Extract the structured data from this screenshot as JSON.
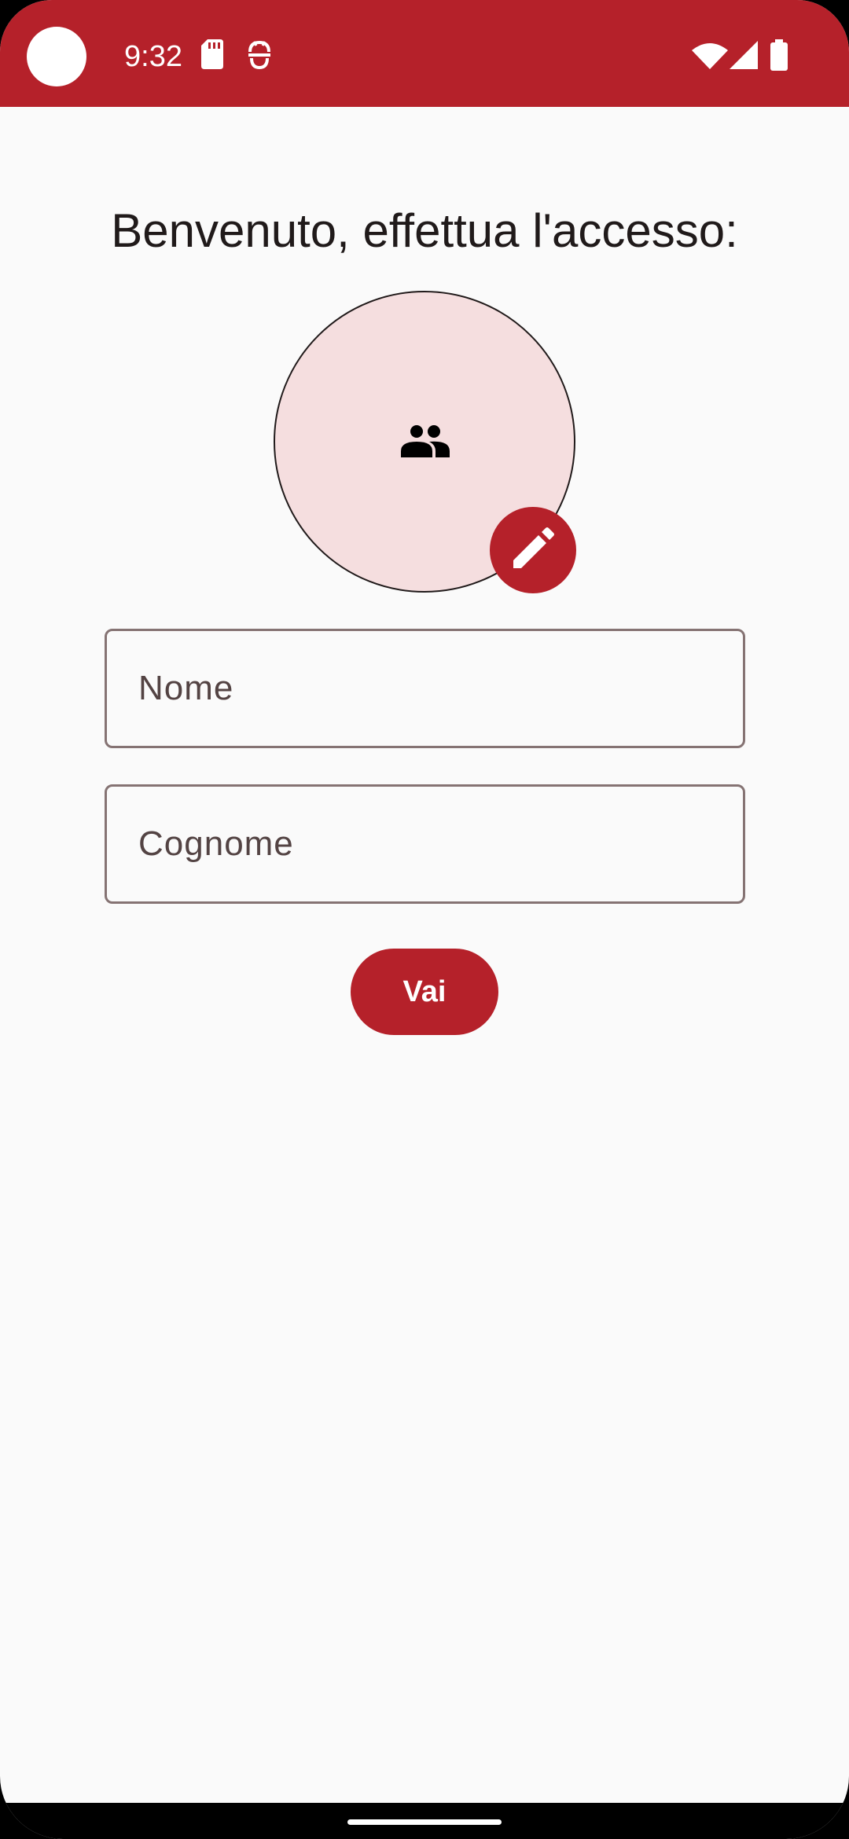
{
  "status_bar": {
    "time": "9:32",
    "icons": [
      "sd-card-icon",
      "debug-icon",
      "wifi-icon",
      "signal-icon",
      "battery-icon"
    ],
    "background_color": "#b5212a"
  },
  "login": {
    "title": "Benvenuto, effettua l'accesso:",
    "avatar_icon": "people-icon",
    "edit_icon": "pencil-icon",
    "first_name_placeholder": "Nome",
    "first_name_value": "",
    "last_name_placeholder": "Cognome",
    "last_name_value": "",
    "submit_label": "Vai"
  },
  "colors": {
    "accent": "#b5212a",
    "avatar_background": "#f5dedf",
    "surface": "#fafafa",
    "field_border": "#857373"
  }
}
